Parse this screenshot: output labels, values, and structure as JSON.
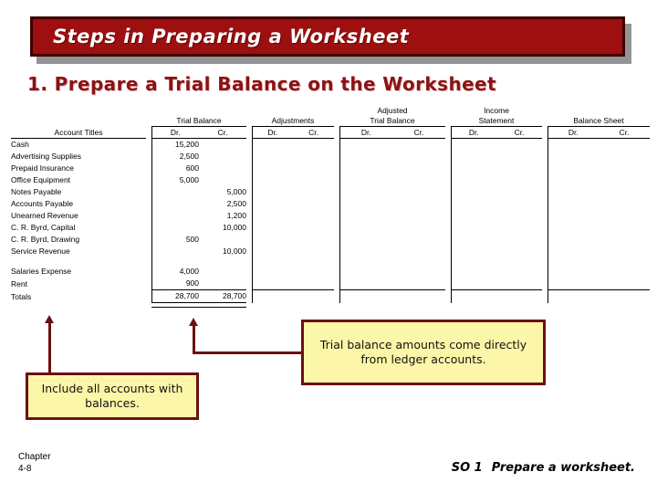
{
  "slide": {
    "title": "Steps in Preparing a Worksheet",
    "subtitle": "1. Prepare a Trial Balance on the Worksheet",
    "title_bar_color": "#9e0f0f",
    "title_border_color": "#3d0000",
    "title_shadow_color": "#949494",
    "subtitle_color": "#8c1212",
    "callout_fill": "#fcf7a8",
    "callout_border": "#6b1111"
  },
  "worksheet": {
    "account_titles_header": "Account Titles",
    "column_groups": [
      {
        "line1": "",
        "line2": "Trial Balance"
      },
      {
        "line1": "",
        "line2": "Adjustments"
      },
      {
        "line1": "Adjusted",
        "line2": "Trial Balance"
      },
      {
        "line1": "Income",
        "line2": "Statement"
      },
      {
        "line1": "",
        "line2": "Balance Sheet"
      }
    ],
    "dr_label": "Dr.",
    "cr_label": "Cr.",
    "rows": [
      {
        "account": "Cash",
        "tb_dr": "15,200",
        "tb_cr": ""
      },
      {
        "account": "Advertising Supplies",
        "tb_dr": "2,500",
        "tb_cr": ""
      },
      {
        "account": "Prepaid Insurance",
        "tb_dr": "600",
        "tb_cr": ""
      },
      {
        "account": "Office Equipment",
        "tb_dr": "5,000",
        "tb_cr": ""
      },
      {
        "account": "Notes Payable",
        "tb_dr": "",
        "tb_cr": "5,000"
      },
      {
        "account": "Accounts Payable",
        "tb_dr": "",
        "tb_cr": "2,500"
      },
      {
        "account": "Unearned Revenue",
        "tb_dr": "",
        "tb_cr": "1,200"
      },
      {
        "account": "C. R. Byrd, Capital",
        "tb_dr": "",
        "tb_cr": "10,000"
      },
      {
        "account": "C. R. Byrd, Drawing",
        "tb_dr": "500",
        "tb_cr": ""
      },
      {
        "account": "Service Revenue",
        "tb_dr": "",
        "tb_cr": "10,000"
      },
      {
        "account": "",
        "tb_dr": "",
        "tb_cr": "",
        "blank": true
      },
      {
        "account": "Salaries Expense",
        "tb_dr": "4,000",
        "tb_cr": ""
      },
      {
        "account": "Rent",
        "tb_dr": "900",
        "tb_cr": ""
      }
    ],
    "totals": {
      "account": "Totals",
      "tb_dr": "28,700",
      "tb_cr": "28,700"
    }
  },
  "callouts": {
    "right": "Trial balance amounts come directly from ledger accounts.",
    "left": "Include all accounts with balances."
  },
  "footer": {
    "chapter_label": "Chapter",
    "chapter_number": "4-8",
    "so_label": "SO 1",
    "so_text": "Prepare a worksheet."
  }
}
